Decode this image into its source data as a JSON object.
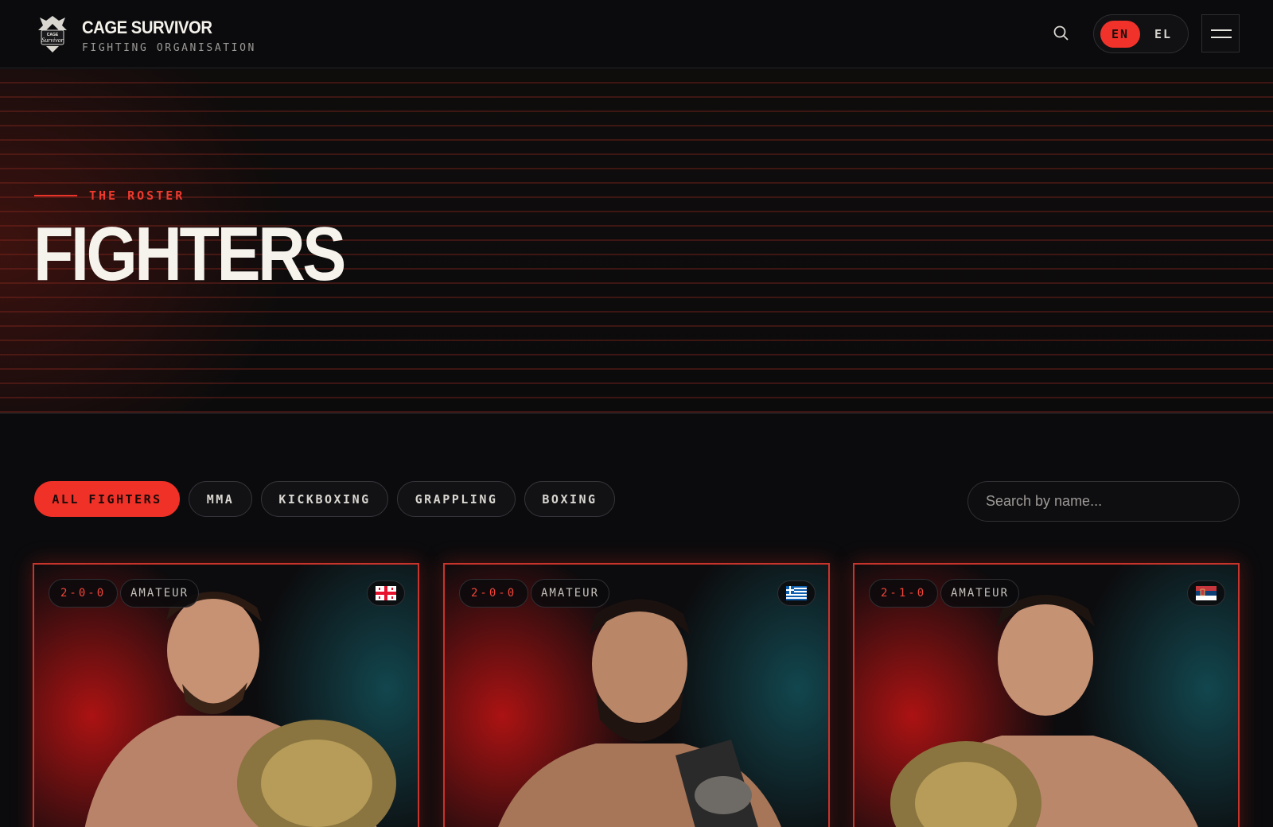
{
  "header": {
    "brand_title": "CAGE SURVIVOR",
    "brand_subtitle": "FIGHTING ORGANISATION",
    "logo_text": "CAGE SURVIVOR",
    "search_icon": "search-icon",
    "languages": [
      {
        "label": "EN",
        "active": true
      },
      {
        "label": "EL",
        "active": false
      }
    ],
    "menu_icon": "hamburger-menu-icon"
  },
  "hero": {
    "eyebrow": "THE ROSTER",
    "title": "FIGHTERS"
  },
  "filters": {
    "chips": [
      {
        "label": "ALL FIGHTERS",
        "active": true
      },
      {
        "label": "MMA",
        "active": false
      },
      {
        "label": "KICKBOXING",
        "active": false
      },
      {
        "label": "GRAPPLING",
        "active": false
      },
      {
        "label": "BOXING",
        "active": false
      }
    ],
    "search_placeholder": "Search by name..."
  },
  "fighters": [
    {
      "record": "2-0-0",
      "level": "AMATEUR",
      "flag": "georgia-flag-icon"
    },
    {
      "record": "2-0-0",
      "level": "AMATEUR",
      "flag": "greece-flag-icon"
    },
    {
      "record": "2-1-0",
      "level": "AMATEUR",
      "flag": "serbia-flag-icon"
    }
  ],
  "colors": {
    "accent": "#ef3127",
    "background": "#0b0b0d",
    "text": "#f6f2ec"
  }
}
